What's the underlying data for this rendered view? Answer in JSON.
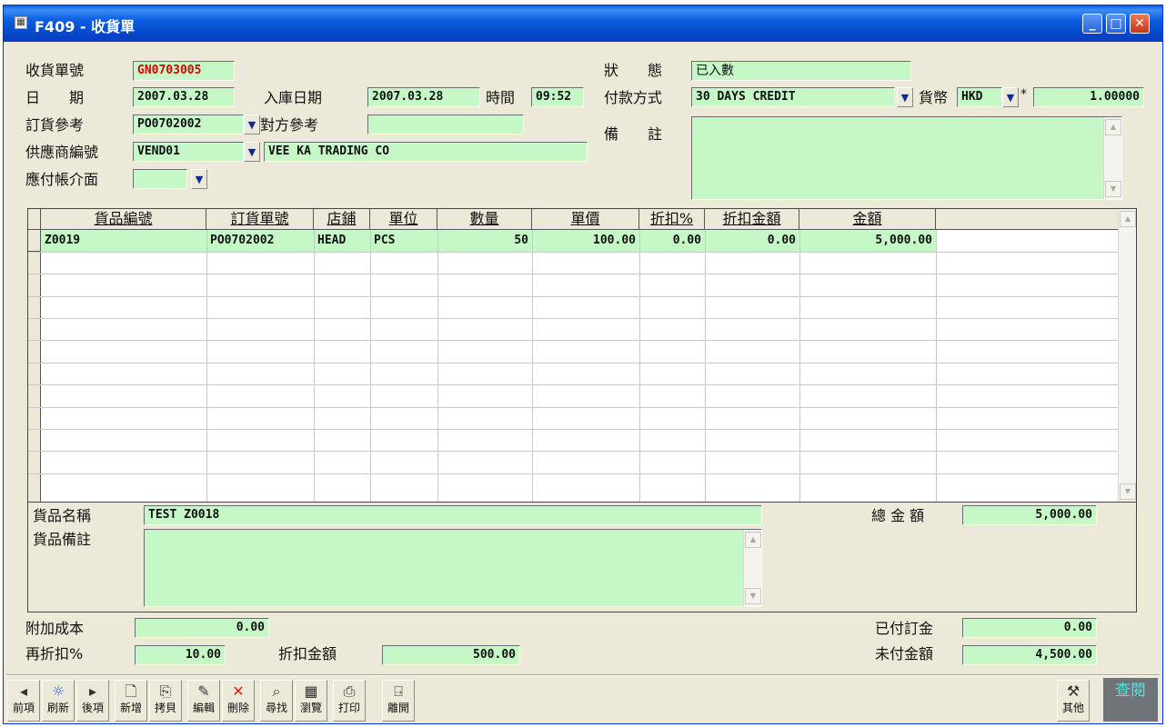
{
  "window": {
    "title": "F409 - 收貨單",
    "title_icon": "grid-icon"
  },
  "header": {
    "receipt_no_label": "收貨單號",
    "receipt_no": "GN0703005",
    "date_label": "日　　期",
    "date": "2007.03.28",
    "stock_in_date_label": "入庫日期",
    "stock_in_date": "2007.03.28",
    "time_label": "時間",
    "time": "09:52",
    "order_ref_label": "訂貨參考",
    "order_ref": "PO0702002",
    "counter_ref_label": "對方參考",
    "counter_ref": "",
    "vendor_no_label": "供應商編號",
    "vendor_no": "VEND01",
    "vendor_name": "VEE KA TRADING CO",
    "ap_interface_label": "應付帳介面",
    "ap_interface": "",
    "status_label": "狀　　態",
    "status": "已入數",
    "payment_label": "付款方式",
    "payment": "30 DAYS CREDIT",
    "currency_label": "貨幣",
    "currency": "HKD",
    "rate_mark": "*",
    "rate": "1.00000",
    "remark_label": "備　　註",
    "remark": ""
  },
  "grid": {
    "columns": [
      "貨品編號",
      "訂貨單號",
      "店鋪",
      "單位",
      "數量",
      "單價",
      "折扣%",
      "折扣金額",
      "金額"
    ],
    "rows": [
      {
        "item_no": "Z0019",
        "po_no": "PO0702002",
        "store": "HEAD",
        "unit": "PCS",
        "qty": "50",
        "price": "100.00",
        "disc_pct": "0.00",
        "disc_amt": "0.00",
        "amount": "5,000.00"
      }
    ]
  },
  "item_detail": {
    "name_label": "貨品名稱",
    "name": "TEST Z0018",
    "remark_label": "貨品備註",
    "remark": "",
    "total_label": "總 金 額",
    "total": "5,000.00"
  },
  "footer": {
    "extra_cost_label": "附加成本",
    "extra_cost": "0.00",
    "re_disc_label": "再折扣%",
    "re_disc": "10.00",
    "disc_amt_label": "折扣金額",
    "disc_amt": "500.00",
    "deposit_label": "已付訂金",
    "deposit": "0.00",
    "unpaid_label": "未付金額",
    "unpaid": "4,500.00"
  },
  "toolbar": {
    "prev": "前項",
    "refresh": "刷新",
    "next": "後項",
    "add": "新增",
    "copy": "拷貝",
    "edit": "編輯",
    "delete": "刪除",
    "find": "尋找",
    "browse": "瀏覽",
    "print": "打印",
    "exit": "離開",
    "other": "其他",
    "mode": "查閱"
  }
}
